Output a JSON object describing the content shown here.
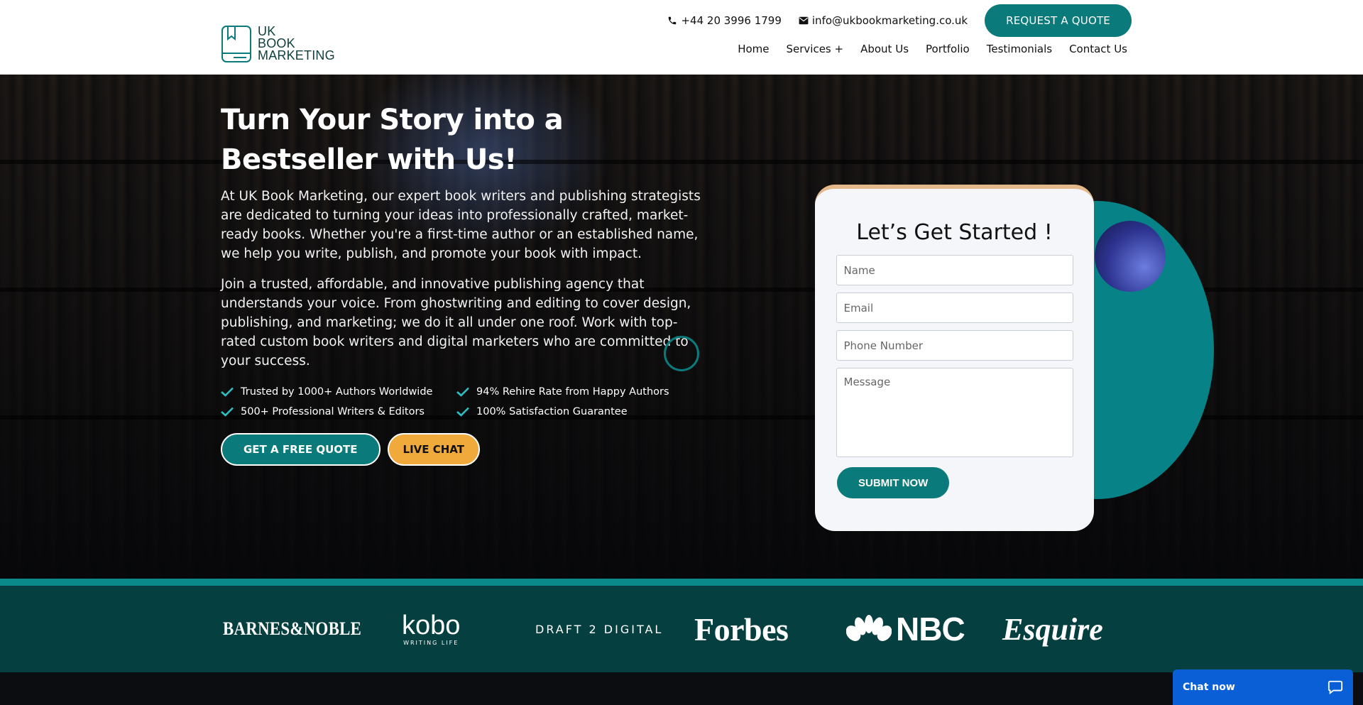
{
  "header": {
    "logo_lines": [
      "UK",
      "BOOK",
      "MARKETING"
    ],
    "phone": "+44 20 3996 1799",
    "email": "info@ukbookmarketing.co.uk",
    "quote_button": "REQUEST A QUOTE",
    "nav": [
      "Home",
      "Services +",
      "About Us",
      "Portfolio",
      "Testimonials",
      "Contact Us"
    ]
  },
  "hero": {
    "title": "Turn Your Story into a Bestseller with Us!",
    "paragraph1": "At UK Book Marketing, our expert book writers and publishing strategists are dedicated to turning your ideas into professionally crafted, market-ready books. Whether you're a first-time author or an established name, we help you write, publish, and promote your book with impact.",
    "paragraph2": "Join a trusted, affordable, and innovative publishing agency that understands your voice. From ghostwriting and editing to cover design, publishing, and marketing; we do it all under one roof. Work with top-rated custom book writers and digital marketers who are committed to your success.",
    "features": [
      "Trusted by 1000+ Authors Worldwide",
      "94% Rehire Rate from Happy Authors",
      "500+ Professional Writers & Editors",
      "100% Satisfaction Guarantee"
    ],
    "cta_quote": "GET A FREE QUOTE",
    "cta_chat": "LIVE CHAT"
  },
  "form": {
    "title": "Let’s Get Started !",
    "name_placeholder": "Name",
    "email_placeholder": "Email",
    "phone_placeholder": "Phone Number",
    "message_placeholder": "Message",
    "submit": "SUBMIT NOW"
  },
  "brands": {
    "barnes": "BARNES&NOBLE",
    "kobo": "kobo",
    "kobo_sub": "WRITING LIFE",
    "draft2digital": "DRAFT 2 DIGITAL",
    "forbes": "Forbes",
    "nbc": "NBC",
    "esquire": "Esquire"
  },
  "chat_widget": {
    "label": "Chat now"
  },
  "colors": {
    "teal": "#0b7a7b",
    "orange": "#f0a93b",
    "strip": "#063f3f"
  }
}
